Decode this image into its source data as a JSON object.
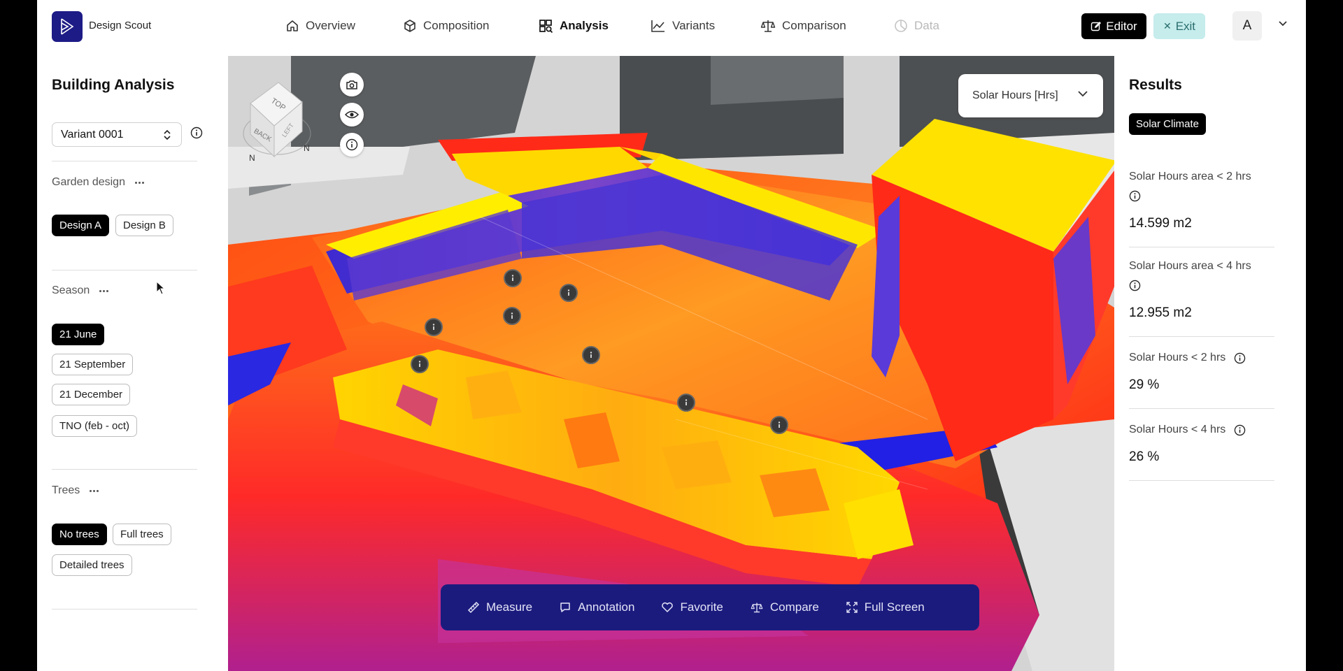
{
  "app": {
    "brand": "Design Scout"
  },
  "nav": [
    {
      "label": "Overview",
      "icon": "home-icon",
      "state": "normal"
    },
    {
      "label": "Composition",
      "icon": "cube-icon",
      "state": "normal"
    },
    {
      "label": "Analysis",
      "icon": "analysis-icon",
      "state": "active"
    },
    {
      "label": "Variants",
      "icon": "chart-line-icon",
      "state": "normal"
    },
    {
      "label": "Comparison",
      "icon": "scale-icon",
      "state": "normal"
    },
    {
      "label": "Data",
      "icon": "pie-icon",
      "state": "disabled"
    }
  ],
  "actions": {
    "editor_label": "Editor",
    "exit_label": "Exit",
    "avatar_initial": "A"
  },
  "left_panel": {
    "title": "Building Analysis",
    "variant": "Variant 0001",
    "garden": {
      "label": "Garden design",
      "options": [
        "Design A",
        "Design B"
      ],
      "selected": 0
    },
    "season": {
      "label": "Season",
      "options": [
        "21 June",
        "21 September",
        "21 December",
        "TNO (feb - oct)"
      ],
      "selected": 0
    },
    "trees": {
      "label": "Trees",
      "options": [
        "No trees",
        "Full trees",
        "Detailed trees"
      ],
      "selected": 0
    }
  },
  "viewport": {
    "metric_dropdown": "Solar Hours [Hrs]",
    "cube_faces": {
      "top": "TOP",
      "back": "BACK",
      "left": "LEFT"
    },
    "compass": "N",
    "toolbar": [
      {
        "label": "Measure",
        "icon": "ruler-icon"
      },
      {
        "label": "Annotation",
        "icon": "comment-icon"
      },
      {
        "label": "Favorite",
        "icon": "heart-icon"
      },
      {
        "label": "Compare",
        "icon": "scale-icon"
      },
      {
        "label": "Full Screen",
        "icon": "fullscreen-icon"
      }
    ],
    "colors": {
      "hot": "#ffee00",
      "mid": "#ff6a1a",
      "warm": "#ff2a18",
      "cool": "#2420e8"
    }
  },
  "results": {
    "title": "Results",
    "badge": "Solar Climate",
    "metrics": [
      {
        "label": "Solar Hours area < 2 hrs",
        "value": "14.599 m2"
      },
      {
        "label": "Solar Hours area < 4 hrs",
        "value": "12.955 m2"
      },
      {
        "label": "Solar Hours < 2 hrs",
        "value": "29 %"
      },
      {
        "label": "Solar Hours < 4 hrs",
        "value": "26 %"
      }
    ]
  }
}
